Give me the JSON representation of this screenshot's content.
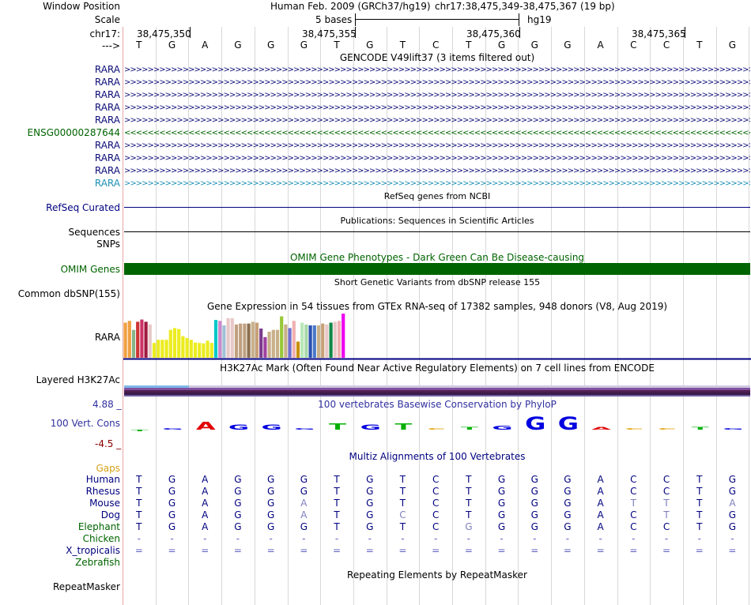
{
  "header": {
    "window_position_label": "Window Position",
    "assembly": "Human Feb. 2009 (GRCh37/hg19)",
    "position": "chr17:38,475,349-38,475,367 (19 bp)",
    "scale_label": "Scale",
    "scale_text": "5 bases",
    "scale_db": "hg19",
    "chrom_label": "chr17:",
    "coords": [
      "38,475,350",
      "38,475,355",
      "38,475,360",
      "38,475,365"
    ],
    "strand_label": "--->"
  },
  "sequence": [
    "T",
    "G",
    "A",
    "G",
    "G",
    "G",
    "T",
    "G",
    "T",
    "C",
    "T",
    "G",
    "G",
    "G",
    "A",
    "C",
    "C",
    "T",
    "G"
  ],
  "gencode": {
    "title": "GENCODE V49lift37 (3 items filtered out)",
    "items": [
      {
        "name": "RARA",
        "color": "#0c0c78",
        "dir": ">"
      },
      {
        "name": "RARA",
        "color": "#0c0c78",
        "dir": ">"
      },
      {
        "name": "RARA",
        "color": "#0c0c78",
        "dir": ">"
      },
      {
        "name": "RARA",
        "color": "#0c0c78",
        "dir": ">"
      },
      {
        "name": "RARA",
        "color": "#0c0c78",
        "dir": ">"
      },
      {
        "name": "ENSG00000287644",
        "color": "#006400",
        "dir": "<"
      },
      {
        "name": "RARA",
        "color": "#0c0c78",
        "dir": ">"
      },
      {
        "name": "RARA",
        "color": "#0c0c78",
        "dir": ">"
      },
      {
        "name": "RARA",
        "color": "#0c0c78",
        "dir": ">"
      },
      {
        "name": "RARA",
        "color": "#1e90b4",
        "dir": ">"
      }
    ]
  },
  "refseq": {
    "title": "RefSeq genes from NCBI",
    "label": "RefSeq Curated"
  },
  "publications": {
    "title": "Publications: Sequences in Scientific Articles",
    "label": "Sequences"
  },
  "snps": {
    "label": "SNPs"
  },
  "omim": {
    "title": "OMIM Gene Phenotypes - Dark Green Can Be Disease-causing",
    "label": "OMIM Genes",
    "color": "#006400"
  },
  "dbsnp": {
    "title": "Short Genetic Variants from dbSNP release 155",
    "label": "Common dbSNP(155)"
  },
  "gtex": {
    "title": "Gene Expression in 54 tissues from GTEx RNA-seq of 17382 samples, 948 donors (V8, Aug 2019)",
    "label": "RARA",
    "bars": [
      {
        "c": "#f0a040",
        "v": 0.78
      },
      {
        "c": "#f0a040",
        "v": 0.82
      },
      {
        "c": "#88b488",
        "v": 0.62
      },
      {
        "c": "#cc3333",
        "v": 0.8
      },
      {
        "c": "#cc3366",
        "v": 0.85
      },
      {
        "c": "#a01840",
        "v": 0.8
      },
      {
        "c": "#e8c8c8",
        "v": 0.74
      },
      {
        "c": "#ecec20",
        "v": 0.33
      },
      {
        "c": "#ecec20",
        "v": 0.4
      },
      {
        "c": "#ecec20",
        "v": 0.4
      },
      {
        "c": "#ecec20",
        "v": 0.4
      },
      {
        "c": "#ecec20",
        "v": 0.62
      },
      {
        "c": "#ecec20",
        "v": 0.66
      },
      {
        "c": "#ecec20",
        "v": 0.64
      },
      {
        "c": "#ecec20",
        "v": 0.48
      },
      {
        "c": "#ecec20",
        "v": 0.44
      },
      {
        "c": "#ecec20",
        "v": 0.4
      },
      {
        "c": "#ecec20",
        "v": 0.34
      },
      {
        "c": "#ecec20",
        "v": 0.33
      },
      {
        "c": "#ecec20",
        "v": 0.32
      },
      {
        "c": "#ecec20",
        "v": 0.38
      },
      {
        "c": "#ecec20",
        "v": 0.33
      },
      {
        "c": "#00c8c8",
        "v": 0.84
      },
      {
        "c": "#cc88cc",
        "v": 0.82
      },
      {
        "c": "#a0c0d8",
        "v": 0.72
      },
      {
        "c": "#e8c8c8",
        "v": 0.88
      },
      {
        "c": "#e8c8c8",
        "v": 0.88
      },
      {
        "c": "#c0a080",
        "v": 0.74
      },
      {
        "c": "#c0a080",
        "v": 0.76
      },
      {
        "c": "#c0a080",
        "v": 0.76
      },
      {
        "c": "#8b7050",
        "v": 0.76
      },
      {
        "c": "#c8b08a",
        "v": 0.8
      },
      {
        "c": "#c8a078",
        "v": 0.78
      },
      {
        "c": "#7a3b8c",
        "v": 0.65
      },
      {
        "c": "#a040a0",
        "v": 0.46
      },
      {
        "c": "#c8b08a",
        "v": 0.58
      },
      {
        "c": "#c8b08a",
        "v": 0.62
      },
      {
        "c": "#c8b08a",
        "v": 0.62
      },
      {
        "c": "#98c838",
        "v": 0.92
      },
      {
        "c": "#c8b08a",
        "v": 0.74
      },
      {
        "c": "#7070d0",
        "v": 0.66
      },
      {
        "c": "#f0b0b0",
        "v": 0.82
      },
      {
        "c": "#c89000",
        "v": 0.36
      },
      {
        "c": "#b8e8b8",
        "v": 0.78
      },
      {
        "c": "#a8d8a8",
        "v": 0.74
      },
      {
        "c": "#2850b0",
        "v": 0.72
      },
      {
        "c": "#4878c8",
        "v": 0.72
      },
      {
        "c": "#c8b08a",
        "v": 0.72
      },
      {
        "c": "#c8a078",
        "v": 0.76
      },
      {
        "c": "#e8c8c8",
        "v": 0.74
      },
      {
        "c": "#108848",
        "v": 0.78
      },
      {
        "c": "#e8c8c8",
        "v": 0.8
      },
      {
        "c": "#f0b0b0",
        "v": 0.82
      },
      {
        "c": "#ee00ee",
        "v": 0.98
      }
    ]
  },
  "h3k27ac": {
    "title": "H3K27Ac Mark (Often Found Near Active Regulatory Elements) on 7 cell lines from ENCODE",
    "label": "Layered H3K27Ac"
  },
  "phylop": {
    "title": "100 vertebrates Basewise Conservation by PhyloP",
    "label": "100 Vert. Cons",
    "max": "4.88 _",
    "min": "-4.5 _",
    "scores": [
      -0.3,
      0.2,
      1.6,
      1.0,
      1.0,
      0.25,
      1.2,
      1.0,
      1.2,
      0.1,
      0.5,
      0.8,
      2.6,
      2.6,
      0.5,
      0.3,
      0.1,
      0.5,
      0.15
    ]
  },
  "multiz": {
    "title": "Multiz Alignments of 100 Vertebrates",
    "gaps_label": "Gaps",
    "species": [
      {
        "name": "Human",
        "seq": [
          "T",
          "G",
          "A",
          "G",
          "G",
          "G",
          "T",
          "G",
          "T",
          "C",
          "T",
          "G",
          "G",
          "G",
          "A",
          "C",
          "C",
          "T",
          "G"
        ]
      },
      {
        "name": "Rhesus",
        "seq": [
          "T",
          "G",
          "A",
          "G",
          "G",
          "G",
          "T",
          "G",
          "T",
          "C",
          "T",
          "G",
          "G",
          "G",
          "A",
          "C",
          "C",
          "T",
          "G"
        ]
      },
      {
        "name": "Mouse",
        "seq": [
          "T",
          "G",
          "A",
          "G",
          "G",
          "A",
          "T",
          "G",
          "T",
          "C",
          "T",
          "G",
          "G",
          "G",
          "A",
          "T",
          "T",
          "T",
          "A"
        ],
        "light": [
          5,
          15,
          16,
          18
        ]
      },
      {
        "name": "Dog",
        "seq": [
          "T",
          "G",
          "A",
          "G",
          "G",
          "A",
          "T",
          "G",
          "C",
          "C",
          "T",
          "G",
          "G",
          "G",
          "A",
          "C",
          "T",
          "T",
          "G"
        ],
        "light": [
          5,
          8,
          16
        ]
      },
      {
        "name": "Elephant",
        "seq": [
          "T",
          "G",
          "A",
          "G",
          "G",
          "G",
          "T",
          "G",
          "T",
          "C",
          "G",
          "G",
          "G",
          "G",
          "A",
          "C",
          "C",
          "T",
          "G"
        ],
        "light": [
          10
        ]
      },
      {
        "name": "Chicken",
        "seq": [
          "-",
          "-",
          "-",
          "-",
          "-",
          "-",
          "-",
          "-",
          "-",
          "-",
          "-",
          "-",
          "-",
          "-",
          "-",
          "-",
          "-",
          "-",
          "-"
        ]
      },
      {
        "name": "X_tropicalis",
        "seq": [
          "=",
          "=",
          "=",
          "=",
          "=",
          "=",
          "=",
          "=",
          "=",
          "=",
          "=",
          "=",
          "=",
          "=",
          "=",
          "=",
          "=",
          "=",
          "="
        ]
      },
      {
        "name": "Zebrafish",
        "seq": []
      }
    ]
  },
  "repeatmasker": {
    "title": "Repeating Elements by RepeatMasker",
    "label": "RepeatMasker"
  },
  "colors": {
    "nav": "#000080",
    "grid": "#c8c8c8",
    "border": "#e6a8a8",
    "gaps": "#d4a017",
    "species_green": "#006400"
  }
}
